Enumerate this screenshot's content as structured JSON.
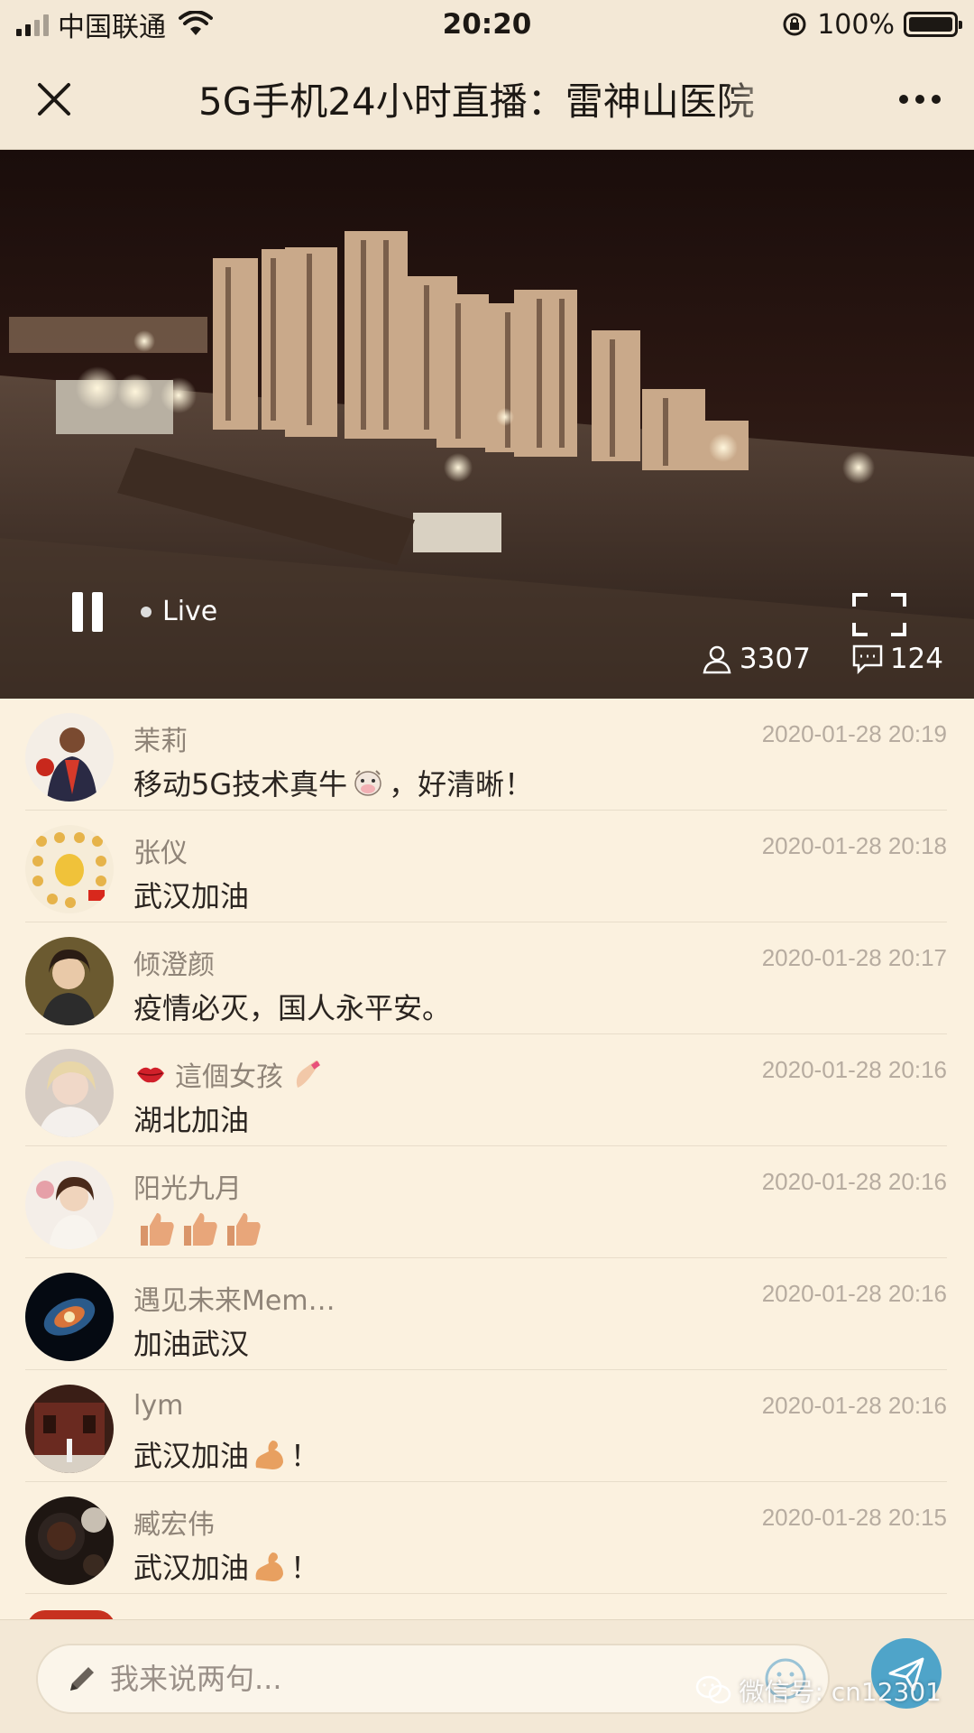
{
  "status_bar": {
    "carrier": "中国联通",
    "time": "20:20",
    "battery": "100%",
    "signal_bars": 2
  },
  "nav": {
    "title": "5G手机24小时直播：雷神山医院"
  },
  "video": {
    "live_label": "Live",
    "viewers": "3307",
    "comment_count": "124"
  },
  "comments": [
    {
      "name": "茉莉",
      "time": "2020-01-28 20:19",
      "text": "移动5G技术真牛",
      "emoji": "cow-face",
      "text_after": "，好清晰！"
    },
    {
      "name": "张仪",
      "time": "2020-01-28 20:18",
      "text": "武汉加油"
    },
    {
      "name": "倾澄颜",
      "time": "2020-01-28 20:17",
      "text": "疫情必灭，国人永平安。"
    },
    {
      "name": "這個女孩",
      "name_emoji_before": "kiss-lips",
      "name_emoji_after": "nail-polish",
      "time": "2020-01-28 20:16",
      "text": "湖北加油"
    },
    {
      "name": "阳光九月",
      "time": "2020-01-28 20:16",
      "text": "",
      "emoji": "thumbs-up-x3"
    },
    {
      "name": "遇见未来Mem…",
      "time": "2020-01-28 20:16",
      "text": "加油武汉"
    },
    {
      "name": "lym",
      "time": "2020-01-28 20:16",
      "text": "武汉加油",
      "emoji": "flexed-biceps",
      "text_after": "！"
    },
    {
      "name": "臧宏伟",
      "time": "2020-01-28 20:15",
      "text": "武汉加油",
      "emoji": "flexed-biceps",
      "text_after": "！"
    }
  ],
  "input": {
    "placeholder": "我来说两句..."
  },
  "watermark": {
    "text": "微信号: cn12301"
  },
  "colors": {
    "background": "#fbf1df",
    "bar": "#f3e8d6",
    "send_button": "#4fa4c9",
    "name": "#8f8478",
    "timestamp": "#b7aca0"
  }
}
